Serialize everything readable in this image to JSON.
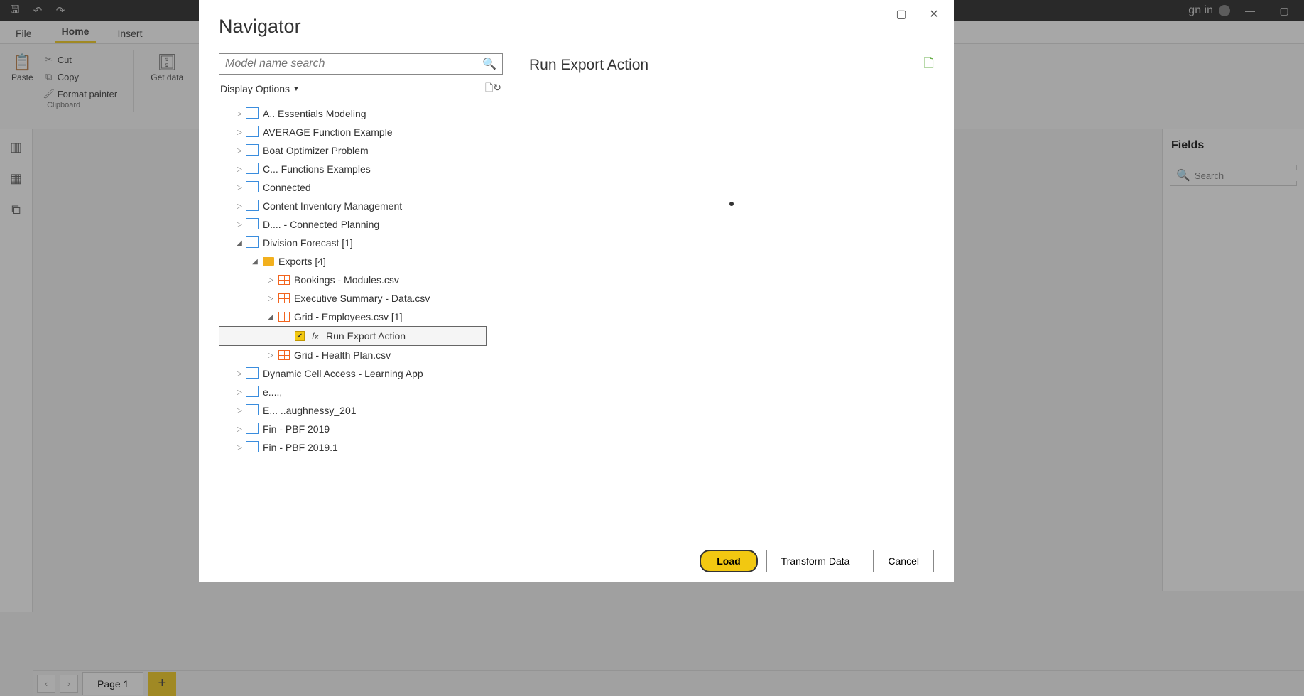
{
  "titlebar": {
    "signin": "gn in"
  },
  "ribbon": {
    "tabs": {
      "file": "File",
      "home": "Home",
      "insert": "Insert"
    },
    "paste": "Paste",
    "cut": "Cut",
    "copy": "Copy",
    "format_painter": "Format painter",
    "clipboard_group": "Clipboard",
    "get_data": "Get data"
  },
  "pagebar": {
    "page1": "Page 1"
  },
  "fields": {
    "header": "Fields",
    "search_placeholder": "Search"
  },
  "modal": {
    "title": "Navigator",
    "search_placeholder": "Model name search",
    "display_options": "Display Options",
    "preview_title": "Run Export Action",
    "buttons": {
      "load": "Load",
      "transform": "Transform Data",
      "cancel": "Cancel"
    },
    "tree": [
      {
        "level": 0,
        "expanded": false,
        "icon": "db",
        "label": "A..  Essentials Modeling",
        "obscured": false
      },
      {
        "level": 0,
        "expanded": false,
        "icon": "db",
        "label": "AVERAGE Function Example"
      },
      {
        "level": 0,
        "expanded": false,
        "icon": "db",
        "label": "Boat Optimizer Problem"
      },
      {
        "level": 0,
        "expanded": false,
        "icon": "db",
        "label": "C...  Functions Examples"
      },
      {
        "level": 0,
        "expanded": false,
        "icon": "db",
        "label": "Connected           "
      },
      {
        "level": 0,
        "expanded": false,
        "icon": "db",
        "label": "Content Inventory Management"
      },
      {
        "level": 0,
        "expanded": false,
        "icon": "db",
        "label": "D....  - Connected Planning"
      },
      {
        "level": 0,
        "expanded": true,
        "icon": "db",
        "label": "Division Forecast [1]"
      },
      {
        "level": 1,
        "expanded": true,
        "icon": "folder",
        "label": "Exports [4]"
      },
      {
        "level": 2,
        "expanded": false,
        "icon": "table",
        "label": "Bookings - Modules.csv"
      },
      {
        "level": 2,
        "expanded": false,
        "icon": "table",
        "label": "Executive Summary - Data.csv"
      },
      {
        "level": 2,
        "expanded": true,
        "icon": "table",
        "label": "Grid - Employees.csv [1]"
      },
      {
        "level": 3,
        "expanded": null,
        "icon": "fx",
        "label": "Run Export Action",
        "checked": true,
        "selected": true
      },
      {
        "level": 2,
        "expanded": false,
        "icon": "table",
        "label": "Grid - Health Plan.csv"
      },
      {
        "level": 0,
        "expanded": false,
        "icon": "db",
        "label": "Dynamic Cell Access - Learning App"
      },
      {
        "level": 0,
        "expanded": false,
        "icon": "db",
        "label": "e....,"
      },
      {
        "level": 0,
        "expanded": false,
        "icon": "db",
        "label": "E... ..aughnessy_201"
      },
      {
        "level": 0,
        "expanded": false,
        "icon": "db",
        "label": "Fin - PBF 2019"
      },
      {
        "level": 0,
        "expanded": false,
        "icon": "db",
        "label": "Fin - PBF 2019.1"
      }
    ]
  }
}
